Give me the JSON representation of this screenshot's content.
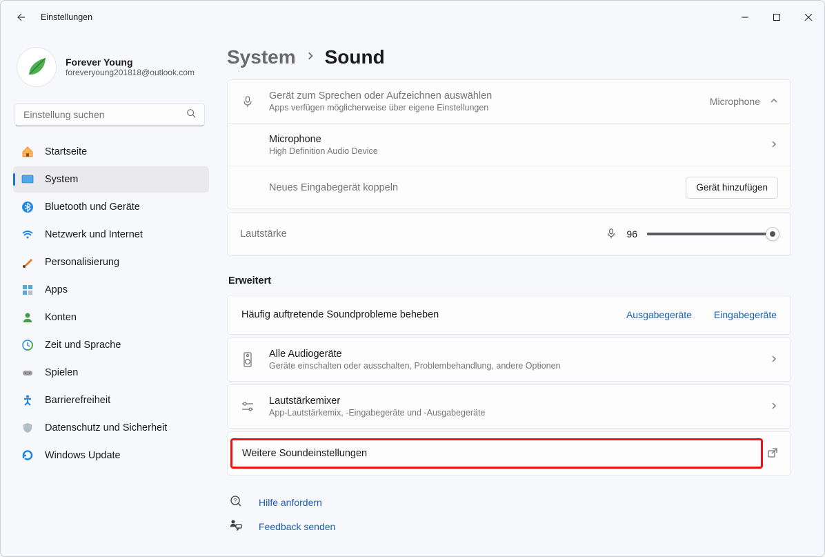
{
  "app_title": "Einstellungen",
  "profile": {
    "name": "Forever Young",
    "email": "foreveryoung201818@outlook.com"
  },
  "search_placeholder": "Einstellung suchen",
  "nav": [
    {
      "key": "home",
      "label": "Startseite"
    },
    {
      "key": "system",
      "label": "System"
    },
    {
      "key": "bluetooth",
      "label": "Bluetooth und Geräte"
    },
    {
      "key": "network",
      "label": "Netzwerk und Internet"
    },
    {
      "key": "personal",
      "label": "Personalisierung"
    },
    {
      "key": "apps",
      "label": "Apps"
    },
    {
      "key": "accounts",
      "label": "Konten"
    },
    {
      "key": "time",
      "label": "Zeit und Sprache"
    },
    {
      "key": "gaming",
      "label": "Spielen"
    },
    {
      "key": "access",
      "label": "Barrierefreiheit"
    },
    {
      "key": "privacy",
      "label": "Datenschutz und Sicherheit"
    },
    {
      "key": "update",
      "label": "Windows Update"
    }
  ],
  "breadcrumb": {
    "parent": "System",
    "current": "Sound"
  },
  "input_section": {
    "title": "Gerät zum Sprechen oder Aufzeichnen auswählen",
    "sub": "Apps verfügen möglicherweise über eigene Einstellungen",
    "selected": "Microphone",
    "device": {
      "title": "Microphone",
      "sub": "High Definition Audio Device"
    },
    "pair_label": "Neues Eingabegerät koppeln",
    "add_button": "Gerät hinzufügen"
  },
  "volume": {
    "label": "Lautstärke",
    "value": "96",
    "percent": 96
  },
  "advanced_label": "Erweitert",
  "troubleshoot": {
    "title": "Häufig auftretende Soundprobleme beheben",
    "output_link": "Ausgabegeräte",
    "input_link": "Eingabegeräte"
  },
  "all_devices": {
    "title": "Alle Audiogeräte",
    "sub": "Geräte einschalten oder ausschalten, Problembehandlung, andere Optionen"
  },
  "mixer": {
    "title": "Lautstärkemixer",
    "sub": "App-Lautstärkemix, -Eingabegeräte und -Ausgabegeräte"
  },
  "more_sound": {
    "title": "Weitere Soundeinstellungen"
  },
  "footer": {
    "help": "Hilfe anfordern",
    "feedback": "Feedback senden"
  }
}
